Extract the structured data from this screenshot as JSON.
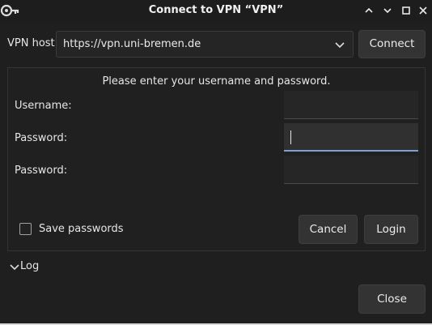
{
  "window": {
    "title": "Connect to VPN “VPN”",
    "app_icon": "key-icon",
    "controls": [
      "minimize-icon",
      "maximize-icon",
      "close-icon"
    ]
  },
  "host": {
    "label": "VPN host",
    "value": "https://vpn.uni-bremen.de",
    "connect_label": "Connect"
  },
  "auth": {
    "prompt": "Please enter your username and password.",
    "fields": [
      {
        "label": "Username:",
        "value": ""
      },
      {
        "label": "Password:",
        "value": ""
      },
      {
        "label": "Password:",
        "value": ""
      }
    ],
    "save_passwords_label": "Save passwords",
    "save_passwords_checked": false,
    "cancel_label": "Cancel",
    "login_label": "Login"
  },
  "log": {
    "label": "Log",
    "expanded": false
  },
  "footer": {
    "close_label": "Close"
  },
  "colors": {
    "focus_accent": "#7aa3d4",
    "background": "#1f1f1f",
    "button": "#333333"
  }
}
